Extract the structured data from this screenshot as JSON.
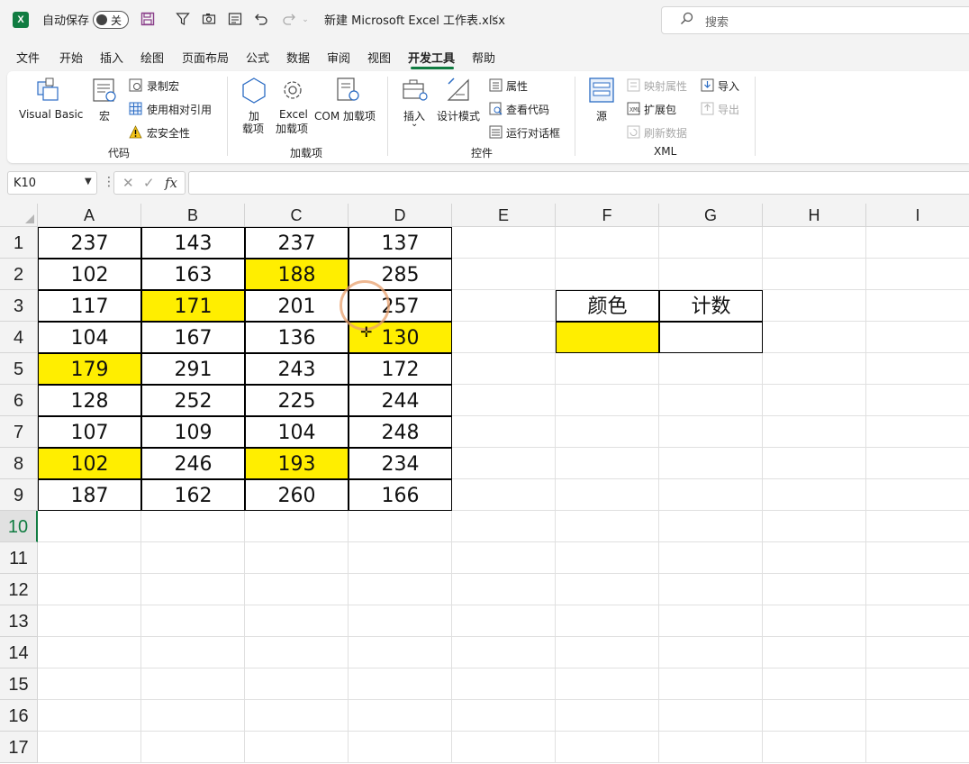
{
  "titlebar": {
    "autosave_label": "自动保存",
    "autosave_state": "关",
    "filename": "新建 Microsoft Excel 工作表.xlsx",
    "search_placeholder": "搜索"
  },
  "menu_tabs": [
    "文件",
    "开始",
    "插入",
    "绘图",
    "页面布局",
    "公式",
    "数据",
    "审阅",
    "视图",
    "开发工具",
    "帮助"
  ],
  "active_tab": "开发工具",
  "ribbon": {
    "code": {
      "name": "代码",
      "visual_basic": "Visual Basic",
      "macros": "宏",
      "record_macro": "录制宏",
      "relative_refs": "使用相对引用",
      "macro_security": "宏安全性"
    },
    "addins": {
      "name": "加载项",
      "addins_l1": "加",
      "addins_l2": "载项",
      "excel_l1": "Excel",
      "excel_l2": "加载项",
      "com": "COM 加载项"
    },
    "controls": {
      "name": "控件",
      "insert": "插入",
      "design_mode": "设计模式",
      "properties": "属性",
      "view_code": "查看代码",
      "run_dialog": "运行对话框"
    },
    "xml": {
      "name": "XML",
      "source": "源",
      "map_props": "映射属性",
      "expansion": "扩展包",
      "refresh": "刷新数据",
      "import": "导入",
      "export": "导出"
    }
  },
  "formula_bar": {
    "name_box": "K10",
    "fx": "fx",
    "formula": ""
  },
  "sheet": {
    "columns": [
      "A",
      "B",
      "C",
      "D",
      "E",
      "F",
      "G",
      "H",
      "I"
    ],
    "rows": [
      "1",
      "2",
      "3",
      "4",
      "5",
      "6",
      "7",
      "8",
      "9",
      "10",
      "11",
      "12",
      "13",
      "14",
      "15",
      "16",
      "17"
    ],
    "selected_row": "10",
    "data": [
      [
        "237",
        "143",
        "237",
        "137"
      ],
      [
        "102",
        "163",
        "188",
        "285"
      ],
      [
        "117",
        "171",
        "201",
        "257"
      ],
      [
        "104",
        "167",
        "136",
        "130"
      ],
      [
        "179",
        "291",
        "243",
        "172"
      ],
      [
        "128",
        "252",
        "225",
        "244"
      ],
      [
        "107",
        "109",
        "104",
        "248"
      ],
      [
        "102",
        "246",
        "193",
        "234"
      ],
      [
        "187",
        "162",
        "260",
        "166"
      ]
    ],
    "highlighted_cells": [
      "C2",
      "B3",
      "D4",
      "A5",
      "A8",
      "C8"
    ],
    "highlight_color": "#ffee00",
    "side_table": {
      "header_color": "颜色",
      "header_count": "计数",
      "color_swatch": "#ffee00",
      "count_value": ""
    }
  }
}
